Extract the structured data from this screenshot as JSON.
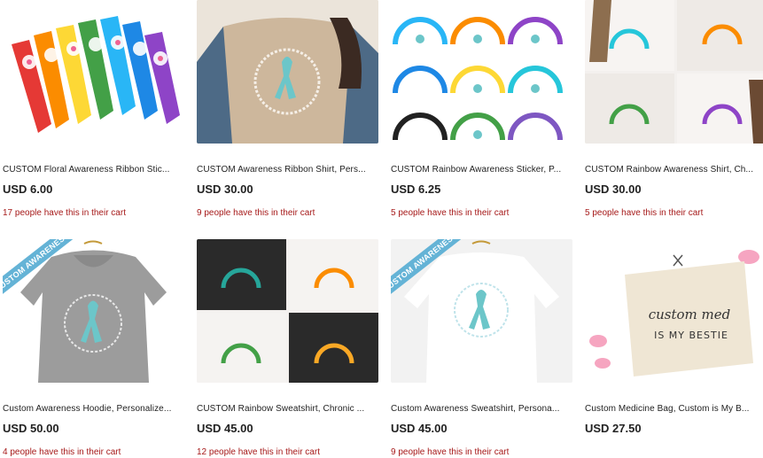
{
  "products": [
    {
      "title": "CUSTOM Floral Awareness Ribbon Stic...",
      "price": "USD 6.00",
      "cart": "17 people have this in their cart",
      "image": "floral-ribbon-stickers"
    },
    {
      "title": "CUSTOM Awareness Ribbon Shirt, Pers...",
      "price": "USD 30.00",
      "cart": "9 people have this in their cart",
      "image": "ribbon-shirt"
    },
    {
      "title": "CUSTOM Rainbow Awareness Sticker, P...",
      "price": "USD 6.25",
      "cart": "5 people have this in their cart",
      "image": "rainbow-stickers"
    },
    {
      "title": "CUSTOM Rainbow Awareness Shirt, Ch...",
      "price": "USD 30.00",
      "cart": "5 people have this in their cart",
      "image": "rainbow-shirts"
    },
    {
      "title": "Custom Awareness Hoodie, Personalize...",
      "price": "USD 50.00",
      "cart": "4 people have this in their cart",
      "image": "awareness-hoodie",
      "banner": "CUSTOM AWARENESS"
    },
    {
      "title": "CUSTOM Rainbow Sweatshirt, Chronic ...",
      "price": "USD 45.00",
      "cart": "12 people have this in their cart",
      "image": "rainbow-sweatshirts"
    },
    {
      "title": "Custom Awareness Sweatshirt, Persona...",
      "price": "USD 45.00",
      "cart": "9 people have this in their cart",
      "image": "awareness-sweatshirt",
      "banner": "CUSTOM AWARENESS"
    },
    {
      "title": "Custom Medicine Bag, Custom is My B...",
      "price": "USD 27.50",
      "cart": "",
      "image": "medicine-bag",
      "bag_text_1": "custom med",
      "bag_text_2": "IS MY BESTIE"
    }
  ],
  "colors": {
    "cart_text": "#a61a1a",
    "banner": "#64b3d6",
    "ribbon": "#6cc6c9"
  }
}
